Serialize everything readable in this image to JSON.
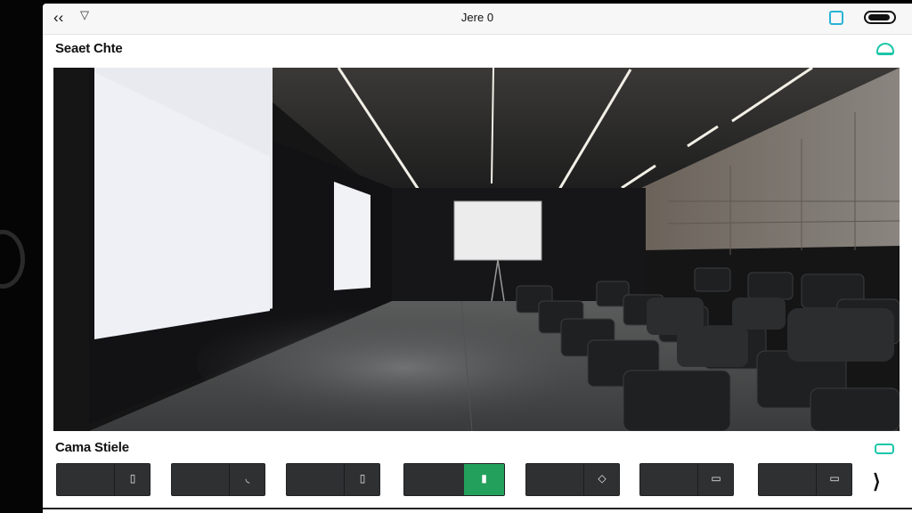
{
  "status_bar": {
    "back_glyph": "‹‹",
    "signal_glyph": "▽",
    "title": "Jere 0",
    "camera_icon": "camera-icon",
    "battery_icon": "battery-icon"
  },
  "preview_section": {
    "title": "Seaet Chte",
    "refresh_icon": "refresh-icon"
  },
  "controls_section": {
    "title": "Cama Stiele",
    "toggle_icon": "toggle-icon",
    "buttons": [
      {
        "glyph": "▯",
        "active": false
      },
      {
        "glyph": "◟",
        "active": false
      },
      {
        "glyph": "▯",
        "active": false
      },
      {
        "glyph": "▮",
        "active": true
      },
      {
        "glyph": "◇",
        "active": false
      },
      {
        "glyph": "▭",
        "active": false
      },
      {
        "glyph": "▭",
        "active": false
      }
    ],
    "next_glyph": "⟩",
    "active_color": "#23a05b"
  }
}
